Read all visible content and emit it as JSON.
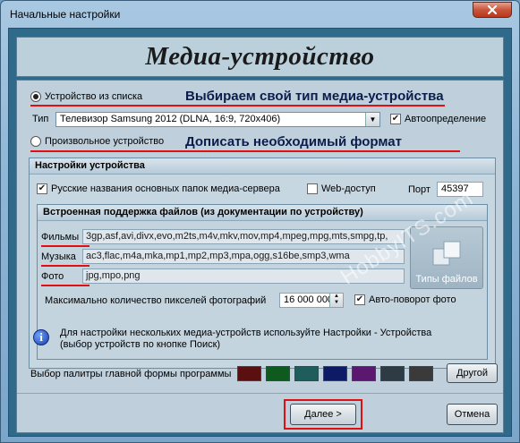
{
  "window": {
    "title": "Начальные настройки",
    "close_icon": "close-icon"
  },
  "header": {
    "title": "Медиа-устройство"
  },
  "device_choice": {
    "from_list_label": "Устройство из списка",
    "from_list_selected": true,
    "annotation_list": "Выбираем свой тип медиа-устройства",
    "type_label": "Тип",
    "type_value": "Телевизор Samsung 2012 (DLNA, 16:9, 720x406)",
    "auto_detect_label": "Автоопределение",
    "auto_detect_checked": true,
    "custom_label": "Произвольное устройство",
    "custom_selected": false,
    "annotation_custom": "Дописать необходимый формат"
  },
  "device_settings": {
    "header": "Настройки устройства",
    "russian_names_label": "Русские названия основных папок медиа-сервера",
    "russian_names_checked": true,
    "web_access_label": "Web-доступ",
    "web_access_checked": false,
    "port_label": "Порт",
    "port_value": "45397"
  },
  "file_support": {
    "header": "Встроенная поддержка файлов (из документации по устройству)",
    "rows": [
      {
        "label": "Фильмы",
        "value": "3gp,asf,avi,divx,evo,m2ts,m4v,mkv,mov,mp4,mpeg,mpg,mts,smpg,tp,"
      },
      {
        "label": "Музыка",
        "value": "ac3,flac,m4a,mka,mp1,mp2,mp3,mpa,ogg,s16be,smp3,wma"
      },
      {
        "label": "Фото",
        "value": "jpg,mpo,png"
      }
    ],
    "file_types_button": "Типы файлов",
    "max_pixels_label": "Максимально количество пикселей фотографий",
    "max_pixels_value": "16 000 000",
    "auto_rotate_label": "Авто-поворот фото",
    "auto_rotate_checked": true
  },
  "info": {
    "icon": "info-icon",
    "text_line1": "Для настройки нескольких медиа-устройств используйте Настройки - Устройства",
    "text_line2": "(выбор устройств по кнопке Поиск)"
  },
  "palette": {
    "label": "Выбор палитры главной формы программы",
    "colors": [
      "#5a1010",
      "#0f5a1e",
      "#1f5c5c",
      "#0d1a66",
      "#5a1870",
      "#2e3b44",
      "#3a3a3a"
    ],
    "other_button": "Другой"
  },
  "footer": {
    "next_button": "Далее >",
    "cancel_button": "Отмена"
  },
  "watermark": "HobbyITS.com",
  "colors": {
    "annotation_red": "#e01010",
    "annotation_text": "#0a1d4a",
    "client_bg": "#2f6a8a",
    "panel_bg": "#bfd0dc"
  }
}
